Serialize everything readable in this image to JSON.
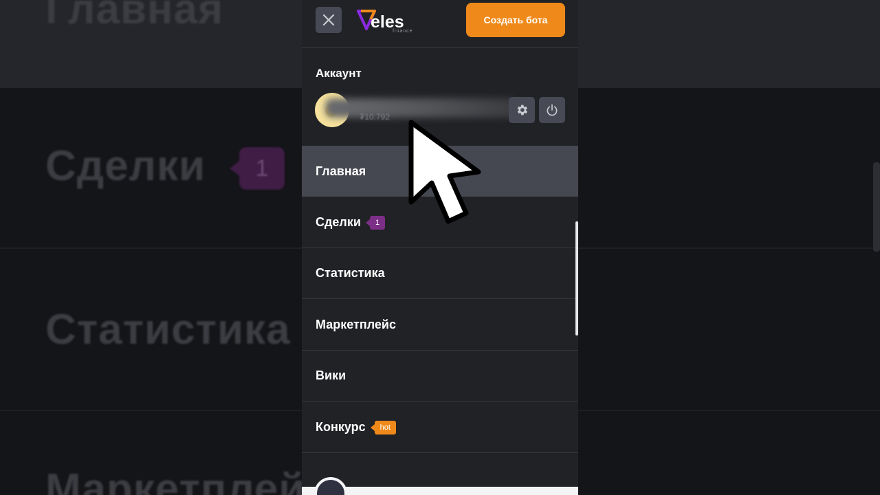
{
  "background": {
    "items": [
      "Главная",
      "Сделки",
      "Статистика",
      "Маркетплейс"
    ],
    "deals_badge": "1"
  },
  "header": {
    "logo_text": "eles",
    "logo_sub": "finance",
    "create_button": "Создать бота"
  },
  "account": {
    "title": "Аккаунт",
    "balance": "₮10.792"
  },
  "nav": [
    {
      "label": "Главная",
      "active": true
    },
    {
      "label": "Сделки",
      "badge": "1",
      "badge_color": "#7b2f86"
    },
    {
      "label": "Статистика"
    },
    {
      "label": "Маркетплейс"
    },
    {
      "label": "Вики"
    },
    {
      "label": "Конкурс",
      "badge": "hot",
      "badge_color": "#ef8a1a"
    }
  ],
  "colors": {
    "accent": "#ef8a1a",
    "panel": "#212226",
    "active_row": "#464851"
  },
  "icons": [
    "close-icon",
    "veles-logo",
    "gear-icon",
    "power-icon",
    "mouse-cursor-icon"
  ]
}
